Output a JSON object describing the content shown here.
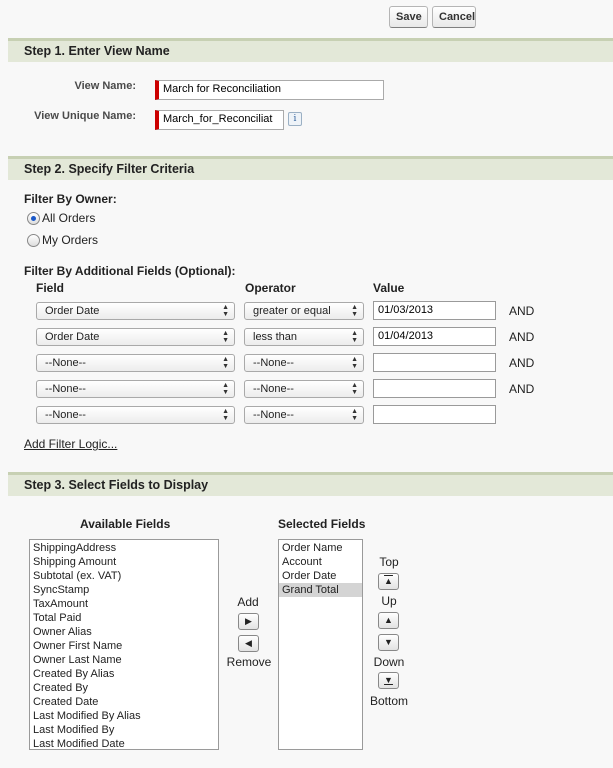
{
  "toolbar": {
    "save_label": "Save",
    "cancel_label": "Cancel"
  },
  "step1": {
    "header": "Step 1. Enter View Name",
    "view_name_label": "View Name:",
    "view_name_value": "March for Reconciliation",
    "unique_name_label": "View Unique Name:",
    "unique_name_value": "March_for_Reconciliat",
    "info_glyph": "i"
  },
  "step2": {
    "header": "Step 2. Specify Filter Criteria",
    "filter_by_owner": "Filter By Owner:",
    "owner_options": [
      {
        "label": "All Orders",
        "checked": true
      },
      {
        "label": "My Orders",
        "checked": false
      }
    ],
    "additional_fields_label": "Filter By Additional Fields (Optional):",
    "col_field": "Field",
    "col_operator": "Operator",
    "col_value": "Value",
    "rows": [
      {
        "field": "Order Date",
        "operator": "greater or equal",
        "value": "01/03/2013",
        "conj": "AND"
      },
      {
        "field": "Order Date",
        "operator": "less than",
        "value": "01/04/2013",
        "conj": "AND"
      },
      {
        "field": "--None--",
        "operator": "--None--",
        "value": "",
        "conj": "AND"
      },
      {
        "field": "--None--",
        "operator": "--None--",
        "value": "",
        "conj": "AND"
      },
      {
        "field": "--None--",
        "operator": "--None--",
        "value": "",
        "conj": ""
      }
    ],
    "add_filter_logic": "Add Filter Logic..."
  },
  "step3": {
    "header": "Step 3. Select Fields to Display",
    "available_label": "Available Fields",
    "selected_label": "Selected Fields",
    "available_fields": [
      "ShippingAddress",
      "Shipping Amount",
      "Subtotal (ex. VAT)",
      "SyncStamp",
      "TaxAmount",
      "Total Paid",
      "Owner Alias",
      "Owner First Name",
      "Owner Last Name",
      "Created By Alias",
      "Created By",
      "Created Date",
      "Last Modified By Alias",
      "Last Modified By",
      "Last Modified Date"
    ],
    "selected_fields": [
      "Order Name",
      "Account",
      "Order Date",
      "Grand Total"
    ],
    "selected_highlight": "Grand Total",
    "add_label": "Add",
    "remove_label": "Remove",
    "top_label": "Top",
    "up_label": "Up",
    "down_label": "Down",
    "bottom_label": "Bottom"
  }
}
